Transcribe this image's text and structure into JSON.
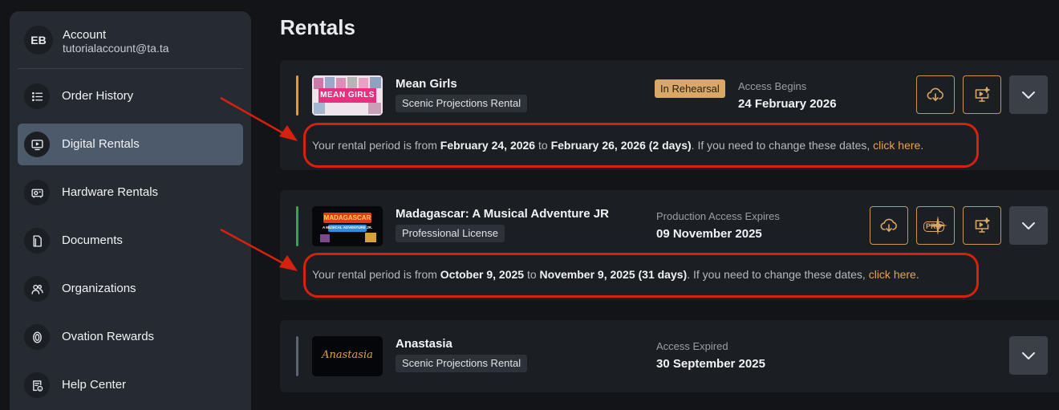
{
  "account": {
    "initials": "EB",
    "name": "Account",
    "email": "tutorialaccount@ta.ta"
  },
  "sidebar": {
    "items": [
      {
        "label": "Order History",
        "icon": "list-icon",
        "active": false
      },
      {
        "label": "Digital Rentals",
        "icon": "monitor-icon",
        "active": true
      },
      {
        "label": "Hardware Rentals",
        "icon": "projector-icon",
        "active": false
      },
      {
        "label": "Documents",
        "icon": "document-icon",
        "active": false
      },
      {
        "label": "Organizations",
        "icon": "people-icon",
        "active": false
      },
      {
        "label": "Ovation Rewards",
        "icon": "award-icon",
        "active": false
      },
      {
        "label": "Help Center",
        "icon": "help-document-icon",
        "active": false
      }
    ]
  },
  "page": {
    "title": "Rentals"
  },
  "rentals": [
    {
      "title": "Mean Girls",
      "license": "Scenic Projections Rental",
      "status": "In Rehearsal",
      "access_label": "Access Begins",
      "access_date": "24 February 2026",
      "accent_color": "#f0942a",
      "thumb_text": "MEAN GIRLS",
      "period": {
        "prefix": "Your rental period is from ",
        "start": "February 24, 2026",
        "mid": " to ",
        "end": "February 26, 2026 (2 days)",
        "suffix": ". If you need to change these dates, ",
        "link": "click here",
        "end_punct": "."
      }
    },
    {
      "title": "Madagascar: A Musical Adventure JR",
      "license": "Professional License",
      "status": "",
      "access_label": "Production Access Expires",
      "access_date": "09 November 2025",
      "accent_color": "#2fa84f",
      "thumb_text": "MADAGASCAR",
      "thumb_sub": "A MUSICAL ADVENTURE JR.",
      "pro_label": "PRO",
      "period": {
        "prefix": "Your rental period is from ",
        "start": "October 9, 2025",
        "mid": " to ",
        "end": "November 9, 2025 (31 days)",
        "suffix": ". If you need to change these dates, ",
        "link": "click here",
        "end_punct": "."
      }
    },
    {
      "title": "Anastasia",
      "license": "Scenic Projections Rental",
      "status": "",
      "access_label": "Access Expired",
      "access_date": "30 September 2025",
      "accent_color": "#5d6572",
      "thumb_text": "Anastasia"
    }
  ],
  "colors": {
    "accent_gold": "#c9974f",
    "link": "#e3a54f",
    "annotation_red": "#d6210f"
  }
}
